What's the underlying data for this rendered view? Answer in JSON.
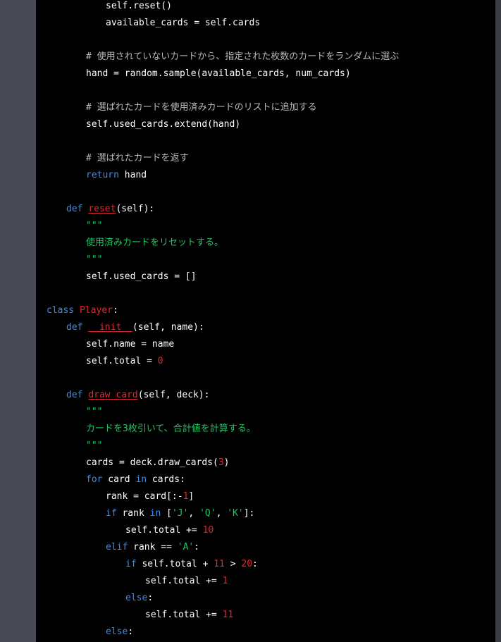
{
  "colors": {
    "background": "#000000",
    "gutter": "#474a52",
    "keyword": "#3b8eea",
    "definition_name": "#e5262e",
    "number": "#e5262e",
    "string": "#1fc462",
    "comment": "#b9b9b9",
    "text": "#ffffff"
  },
  "editor": {
    "lines": [
      {
        "indent": 3,
        "tokens": [
          {
            "t": "self.reset()",
            "c": "plain"
          }
        ]
      },
      {
        "indent": 3,
        "tokens": [
          {
            "t": "available_cards = self.cards",
            "c": "plain"
          }
        ]
      },
      {
        "indent": 0,
        "tokens": []
      },
      {
        "indent": 2,
        "tokens": [
          {
            "t": "# 使用されていないカードから、指定された枚数のカードをランダムに選ぶ",
            "c": "cmt"
          }
        ]
      },
      {
        "indent": 2,
        "tokens": [
          {
            "t": "hand = random.sample(available_cards, num_cards)",
            "c": "plain"
          }
        ]
      },
      {
        "indent": 0,
        "tokens": []
      },
      {
        "indent": 2,
        "tokens": [
          {
            "t": "# 選ばれたカードを使用済みカードのリストに追加する",
            "c": "cmt"
          }
        ]
      },
      {
        "indent": 2,
        "tokens": [
          {
            "t": "self.used_cards.extend(hand)",
            "c": "plain"
          }
        ]
      },
      {
        "indent": 0,
        "tokens": []
      },
      {
        "indent": 2,
        "tokens": [
          {
            "t": "# 選ばれたカードを返す",
            "c": "cmt"
          }
        ]
      },
      {
        "indent": 2,
        "tokens": [
          {
            "t": "return",
            "c": "kw"
          },
          {
            "t": " hand",
            "c": "plain"
          }
        ]
      },
      {
        "indent": 0,
        "tokens": []
      },
      {
        "indent": 1,
        "tokens": [
          {
            "t": "def",
            "c": "kw"
          },
          {
            "t": " ",
            "c": "plain"
          },
          {
            "t": "reset",
            "c": "def",
            "u": true
          },
          {
            "t": "(self):",
            "c": "plain"
          }
        ]
      },
      {
        "indent": 2,
        "tokens": [
          {
            "t": "\"\"\"",
            "c": "doc"
          }
        ]
      },
      {
        "indent": 2,
        "tokens": [
          {
            "t": "使用済みカードをリセットする。",
            "c": "doc"
          }
        ]
      },
      {
        "indent": 2,
        "tokens": [
          {
            "t": "\"\"\"",
            "c": "doc"
          }
        ]
      },
      {
        "indent": 2,
        "tokens": [
          {
            "t": "self.used_cards = []",
            "c": "plain"
          }
        ]
      },
      {
        "indent": 0,
        "tokens": []
      },
      {
        "indent": 0,
        "tokens": [
          {
            "t": "class",
            "c": "kw"
          },
          {
            "t": " ",
            "c": "plain"
          },
          {
            "t": "Player",
            "c": "def"
          },
          {
            "t": ":",
            "c": "plain"
          }
        ]
      },
      {
        "indent": 1,
        "tokens": [
          {
            "t": "def",
            "c": "kw"
          },
          {
            "t": " ",
            "c": "plain"
          },
          {
            "t": "__init__",
            "c": "def",
            "u": true
          },
          {
            "t": "(self, name):",
            "c": "plain"
          }
        ]
      },
      {
        "indent": 2,
        "tokens": [
          {
            "t": "self.name = name",
            "c": "plain"
          }
        ]
      },
      {
        "indent": 2,
        "tokens": [
          {
            "t": "self.total = ",
            "c": "plain"
          },
          {
            "t": "0",
            "c": "num"
          }
        ]
      },
      {
        "indent": 0,
        "tokens": []
      },
      {
        "indent": 1,
        "tokens": [
          {
            "t": "def",
            "c": "kw"
          },
          {
            "t": " ",
            "c": "plain"
          },
          {
            "t": "draw_card",
            "c": "def",
            "u": true
          },
          {
            "t": "(self, deck):",
            "c": "plain"
          }
        ]
      },
      {
        "indent": 2,
        "tokens": [
          {
            "t": "\"\"\"",
            "c": "doc"
          }
        ]
      },
      {
        "indent": 2,
        "tokens": [
          {
            "t": "カードを3枚引いて、合計値を計算する。",
            "c": "doc"
          }
        ]
      },
      {
        "indent": 2,
        "tokens": [
          {
            "t": "\"\"\"",
            "c": "doc"
          }
        ]
      },
      {
        "indent": 2,
        "tokens": [
          {
            "t": "cards = deck.draw_cards(",
            "c": "plain"
          },
          {
            "t": "3",
            "c": "num"
          },
          {
            "t": ")",
            "c": "plain"
          }
        ]
      },
      {
        "indent": 2,
        "tokens": [
          {
            "t": "for",
            "c": "kw"
          },
          {
            "t": " card ",
            "c": "plain"
          },
          {
            "t": "in",
            "c": "kw"
          },
          {
            "t": " cards:",
            "c": "plain"
          }
        ]
      },
      {
        "indent": 3,
        "tokens": [
          {
            "t": "rank = card[:-",
            "c": "plain"
          },
          {
            "t": "1",
            "c": "num"
          },
          {
            "t": "]",
            "c": "plain"
          }
        ]
      },
      {
        "indent": 3,
        "tokens": [
          {
            "t": "if",
            "c": "kw"
          },
          {
            "t": " rank ",
            "c": "plain"
          },
          {
            "t": "in",
            "c": "kw"
          },
          {
            "t": " [",
            "c": "plain"
          },
          {
            "t": "'J'",
            "c": "str"
          },
          {
            "t": ", ",
            "c": "plain"
          },
          {
            "t": "'Q'",
            "c": "str"
          },
          {
            "t": ", ",
            "c": "plain"
          },
          {
            "t": "'K'",
            "c": "str"
          },
          {
            "t": "]:",
            "c": "plain"
          }
        ]
      },
      {
        "indent": 4,
        "tokens": [
          {
            "t": "self.total += ",
            "c": "plain"
          },
          {
            "t": "10",
            "c": "num"
          }
        ]
      },
      {
        "indent": 3,
        "tokens": [
          {
            "t": "elif",
            "c": "kw"
          },
          {
            "t": " rank == ",
            "c": "plain"
          },
          {
            "t": "'A'",
            "c": "str"
          },
          {
            "t": ":",
            "c": "plain"
          }
        ]
      },
      {
        "indent": 4,
        "tokens": [
          {
            "t": "if",
            "c": "kw"
          },
          {
            "t": " self.total + ",
            "c": "plain"
          },
          {
            "t": "11",
            "c": "num"
          },
          {
            "t": " > ",
            "c": "plain"
          },
          {
            "t": "20",
            "c": "num"
          },
          {
            "t": ":",
            "c": "plain"
          }
        ]
      },
      {
        "indent": 5,
        "tokens": [
          {
            "t": "self.total += ",
            "c": "plain"
          },
          {
            "t": "1",
            "c": "num"
          }
        ]
      },
      {
        "indent": 4,
        "tokens": [
          {
            "t": "else",
            "c": "kw"
          },
          {
            "t": ":",
            "c": "plain"
          }
        ]
      },
      {
        "indent": 5,
        "tokens": [
          {
            "t": "self.total += ",
            "c": "plain"
          },
          {
            "t": "11",
            "c": "num"
          }
        ]
      },
      {
        "indent": 3,
        "tokens": [
          {
            "t": "else",
            "c": "kw"
          },
          {
            "t": ":",
            "c": "plain"
          }
        ]
      }
    ]
  }
}
